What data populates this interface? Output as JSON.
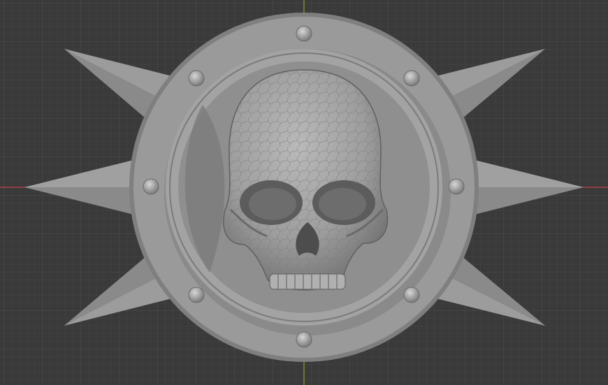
{
  "viewport": {
    "background": "#3a3a3a",
    "grid_minor_color": "#444444",
    "grid_major_color": "#4e4e4e",
    "x_axis_color": "#c0424f",
    "y_axis_color": "#7fa32a"
  },
  "model": {
    "object": "skull-shield-emblem",
    "spike_count": 6,
    "rivet_count": 8,
    "base_color": "#8f8f8f",
    "rim_color": "#9a9a9a",
    "inner_color": "#7d7d7d",
    "skull_color": "#a4a4a4"
  }
}
